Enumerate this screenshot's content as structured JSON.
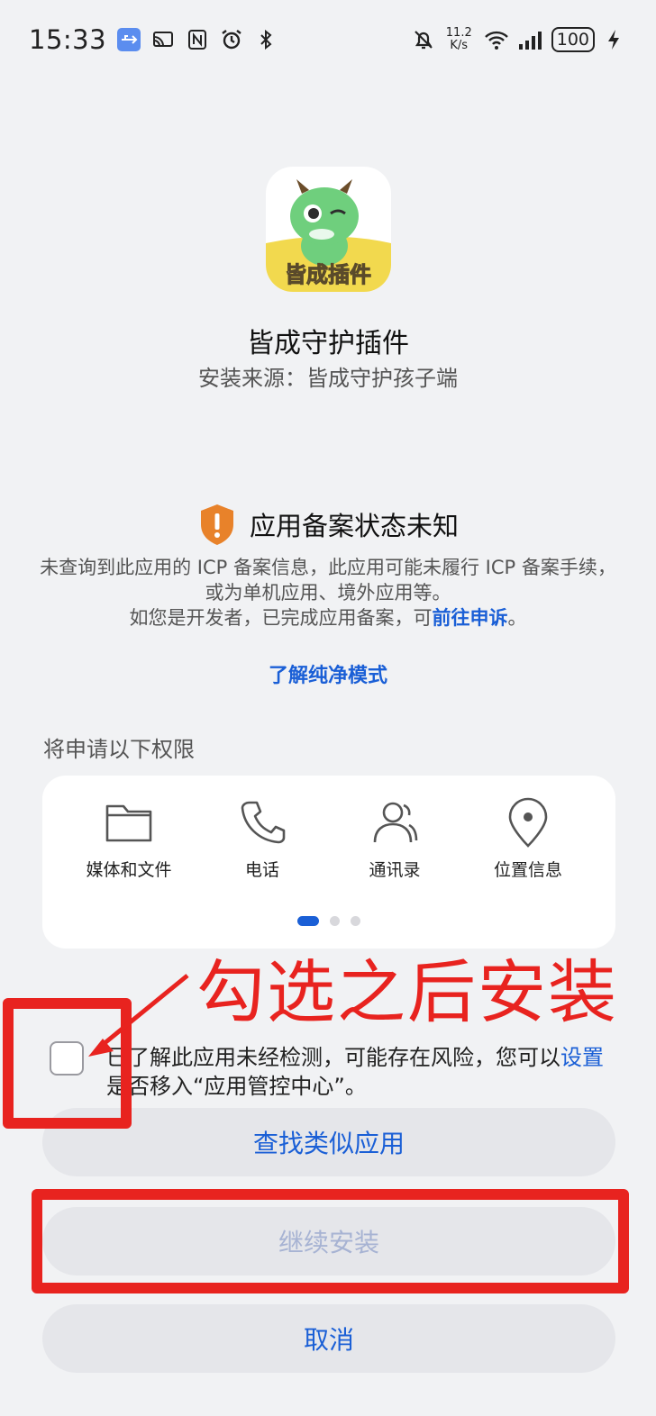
{
  "status_bar": {
    "time": "15:33",
    "net_speed_value": "11.2",
    "net_speed_unit": "K/s",
    "battery": "100"
  },
  "app": {
    "icon_text": "皆成插件",
    "name": "皆成守护插件",
    "source": "安装来源：皆成守护孩子端"
  },
  "icp": {
    "title": "应用备案状态未知",
    "line1": "未查询到此应用的 ICP 备案信息，此应用可能未履行 ICP 备案手续，或为单机应用、境外应用等。",
    "line2_prefix": "如您是开发者，已完成应用备案，可",
    "line2_link": "前往申诉",
    "line2_suffix": "。",
    "pure_mode_link": "了解纯净模式"
  },
  "permissions": {
    "title": "将申请以下权限",
    "items": [
      {
        "label": "媒体和文件",
        "icon": "folder-icon"
      },
      {
        "label": "电话",
        "icon": "phone-icon"
      },
      {
        "label": "通讯录",
        "icon": "contacts-icon"
      },
      {
        "label": "位置信息",
        "icon": "location-icon"
      }
    ]
  },
  "annotation": {
    "text": "勾选之后安装",
    "color": "#e8231f"
  },
  "consent": {
    "prefix": "已了解此应用未经检测，可能存在风险，您可以",
    "link": "设置",
    "suffix": "是否移入“应用管控中心”。"
  },
  "buttons": {
    "find_similar": "查找类似应用",
    "continue_install": "继续安装",
    "cancel": "取消"
  },
  "colors": {
    "accent": "#1a5fd6",
    "warning": "#e8822a",
    "annotation": "#e8231f"
  }
}
